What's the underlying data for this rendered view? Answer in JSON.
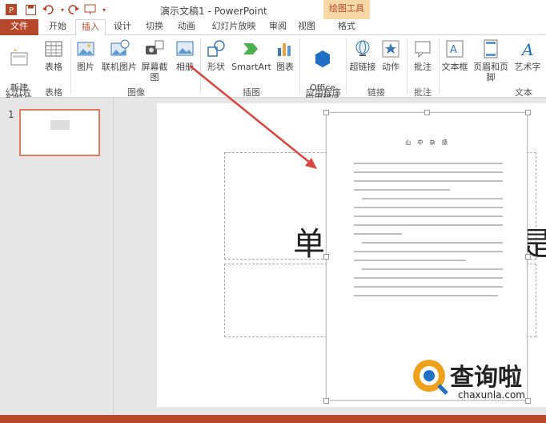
{
  "window": {
    "title": "演示文稿1 - PowerPoint",
    "context_tab_title": "绘图工具"
  },
  "tabs": [
    "文件",
    "开始",
    "插入",
    "设计",
    "切换",
    "动画",
    "幻灯片放映",
    "审阅",
    "视图",
    "格式"
  ],
  "active_tab": "插入",
  "ribbon": {
    "new_slide": "新建\n幻灯片",
    "table": "表格",
    "pictures": "图片",
    "online_pictures": "联机图片",
    "screenshot": "屏幕截图",
    "album": "相册",
    "shapes": "形状",
    "smartart": "SmartArt",
    "chart": "图表",
    "office_apps": "Office\n应用程序",
    "hyperlink": "超链接",
    "action": "动作",
    "comment": "批注",
    "textbox": "文本框",
    "header_footer": "页眉和页脚",
    "wordart": "艺术字",
    "groups": {
      "slides": "幻灯片",
      "tables": "表格",
      "images": "图像",
      "illustrations": "插图",
      "apps": "应用程序",
      "links": "链接",
      "comments": "批注",
      "text": "文本"
    }
  },
  "thumbnail": {
    "number": "1"
  },
  "slide": {
    "title_char_left": "单",
    "title_char_right": "是"
  },
  "pasted_document": {
    "title": "山 中 杂 感"
  },
  "watermark": {
    "text": "查询啦",
    "url": "chaxunla.com"
  },
  "colors": {
    "accent": "#b7472a",
    "arrow": "#d9453e"
  }
}
